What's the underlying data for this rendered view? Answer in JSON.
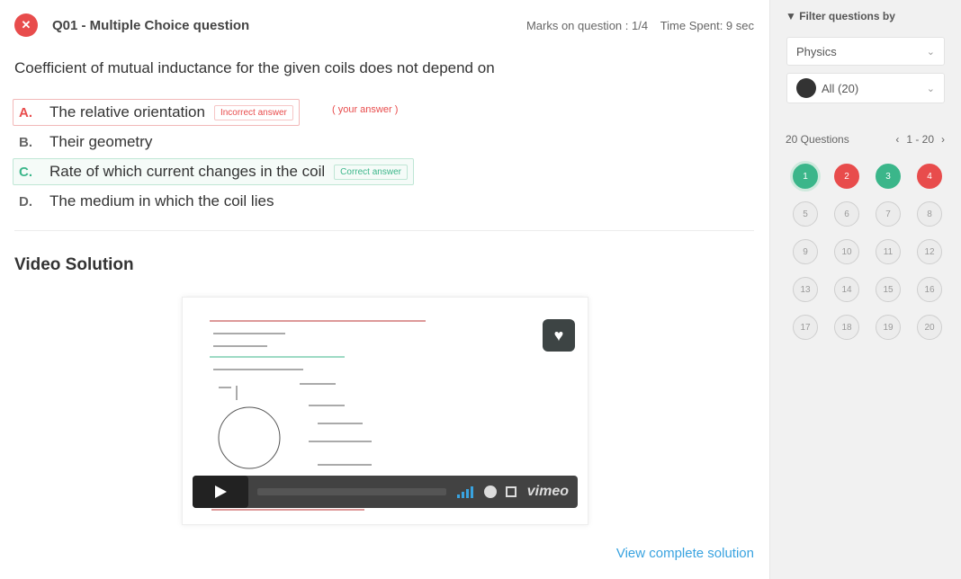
{
  "question": {
    "status_icon": "✕",
    "title": "Q01 - Multiple Choice question",
    "marks": "Marks on question : 1/4",
    "time_spent": "Time Spent: 9 sec",
    "text": "Coefficient of mutual inductance for the given coils does not depend on"
  },
  "options": [
    {
      "letter": "A.",
      "text": "The relative orientation",
      "tag": "Incorrect answer",
      "extra": "( your answer )"
    },
    {
      "letter": "B.",
      "text": "Their geometry",
      "tag": "",
      "extra": ""
    },
    {
      "letter": "C.",
      "text": "Rate of which current changes in the coil",
      "tag": "Correct answer",
      "extra": ""
    },
    {
      "letter": "D.",
      "text": "The medium in which the coil lies",
      "tag": "",
      "extra": ""
    }
  ],
  "solution": {
    "title": "Video Solution",
    "view_link": "View complete solution",
    "player_brand": "vimeo"
  },
  "sidebar": {
    "filter_label": "▼ Filter questions by",
    "subject": "Physics",
    "user": "All (20)",
    "count_label": "20 Questions",
    "pager": {
      "prev": "‹",
      "range": "1 - 20",
      "next": "›"
    },
    "grid": [
      {
        "n": "1",
        "state": "correct-selected"
      },
      {
        "n": "2",
        "state": "incorrect"
      },
      {
        "n": "3",
        "state": "correct"
      },
      {
        "n": "4",
        "state": "incorrect"
      },
      {
        "n": "5",
        "state": "unattempted"
      },
      {
        "n": "6",
        "state": "unattempted"
      },
      {
        "n": "7",
        "state": "unattempted"
      },
      {
        "n": "8",
        "state": "unattempted"
      },
      {
        "n": "9",
        "state": "unattempted"
      },
      {
        "n": "10",
        "state": "unattempted"
      },
      {
        "n": "11",
        "state": "unattempted"
      },
      {
        "n": "12",
        "state": "unattempted"
      },
      {
        "n": "13",
        "state": "unattempted"
      },
      {
        "n": "14",
        "state": "unattempted"
      },
      {
        "n": "15",
        "state": "unattempted"
      },
      {
        "n": "16",
        "state": "unattempted"
      },
      {
        "n": "17",
        "state": "unattempted"
      },
      {
        "n": "18",
        "state": "unattempted"
      },
      {
        "n": "19",
        "state": "unattempted"
      },
      {
        "n": "20",
        "state": "unattempted"
      }
    ]
  },
  "colors": {
    "correct": "#3bb68a",
    "incorrect": "#e84c4c",
    "link": "#39a3e0"
  }
}
